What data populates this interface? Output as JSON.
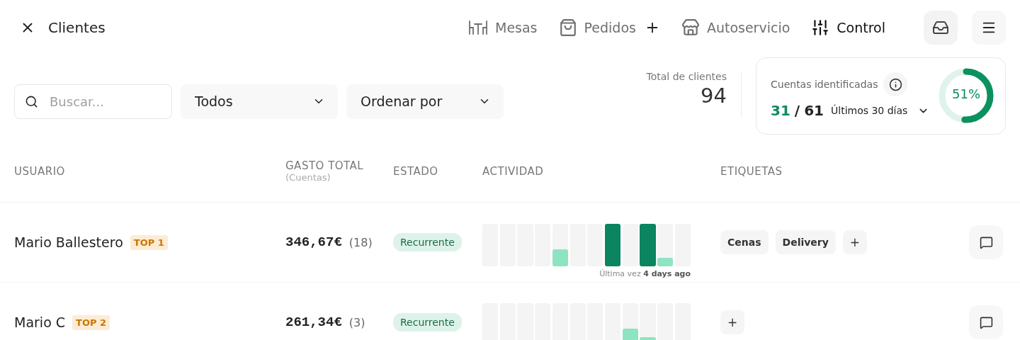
{
  "header": {
    "title": "Clientes",
    "nav": [
      {
        "label": "Mesas",
        "kind": "tables",
        "selected": false,
        "add": false
      },
      {
        "label": "Pedidos",
        "kind": "bag",
        "selected": false,
        "add": true
      },
      {
        "label": "Autoservicio",
        "kind": "store",
        "selected": false,
        "add": false
      },
      {
        "label": "Control",
        "kind": "sliders",
        "selected": true,
        "add": false
      }
    ]
  },
  "toolbar": {
    "search": {
      "placeholder": "Buscar..."
    },
    "filters": [
      "Todos",
      "Ordenar por"
    ]
  },
  "stats": {
    "total_label": "Total de clientes",
    "total_value": "94",
    "card": {
      "title": "Cuentas identificadas",
      "identified": "31",
      "separator": "/",
      "total": "61",
      "period": "Últimos 30 días",
      "percent": "51%",
      "level": 0.51
    }
  },
  "table": {
    "columns": [
      {
        "title": "USUARIO"
      },
      {
        "title": "GASTO TOTAL",
        "subtitle": "(Cuentas)"
      },
      {
        "title": "ESTADO"
      },
      {
        "title": "ACTIVIDAD"
      },
      {
        "title": "ETIQUETAS"
      }
    ],
    "rows": [
      {
        "name": "Mario Ballestero",
        "rank": "TOP 1",
        "amount": "346,67€",
        "count": "(18)",
        "status": "Recurrente",
        "bars": [
          {
            "kind": "none"
          },
          {
            "kind": "none"
          },
          {
            "kind": "none"
          },
          {
            "kind": "none"
          },
          {
            "kind": "mid"
          },
          {
            "kind": "none"
          },
          {
            "kind": "none"
          },
          {
            "kind": "high"
          },
          {
            "kind": "none"
          },
          {
            "kind": "high"
          },
          {
            "kind": "low"
          },
          {
            "kind": "none"
          }
        ],
        "last_seen": "Última vez **4 days ago**",
        "tags": [
          "Cenas",
          "Delivery"
        ],
        "add_tag": "+"
      },
      {
        "name": "Mario C",
        "rank": "TOP 2",
        "amount": "261,34€",
        "count": "(3)",
        "status": "Recurrente",
        "bars": [
          {
            "kind": "none"
          },
          {
            "kind": "none"
          },
          {
            "kind": "none"
          },
          {
            "kind": "none"
          },
          {
            "kind": "none"
          },
          {
            "kind": "none"
          },
          {
            "kind": "none"
          },
          {
            "kind": "none"
          },
          {
            "kind": "mid"
          },
          {
            "kind": "low"
          },
          {
            "kind": "none"
          },
          {
            "kind": "none"
          }
        ],
        "tags": [],
        "add_tag": "+"
      }
    ]
  }
}
